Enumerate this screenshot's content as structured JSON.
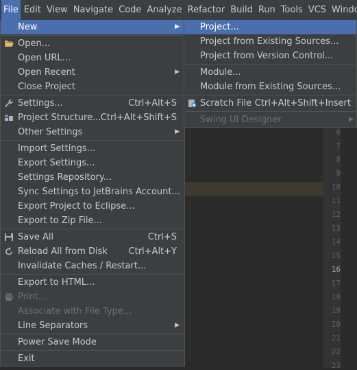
{
  "menubar": {
    "items": [
      "File",
      "Edit",
      "View",
      "Navigate",
      "Code",
      "Analyze",
      "Refactor",
      "Build",
      "Run",
      "Tools",
      "VCS",
      "Window"
    ]
  },
  "file_menu": {
    "new": "New",
    "open": "Open...",
    "open_url": "Open URL...",
    "open_recent": "Open Recent",
    "close_project": "Close Project",
    "settings": "Settings...",
    "settings_shortcut": "Ctrl+Alt+S",
    "project_structure": "Project Structure...",
    "project_structure_shortcut": "Ctrl+Alt+Shift+S",
    "other_settings": "Other Settings",
    "import_settings": "Import Settings...",
    "export_settings": "Export Settings...",
    "settings_repository": "Settings Repository...",
    "sync_settings": "Sync Settings to JetBrains Account...",
    "export_eclipse": "Export Project to Eclipse...",
    "export_zip": "Export to Zip File...",
    "save_all": "Save All",
    "save_all_shortcut": "Ctrl+S",
    "reload_all": "Reload All from Disk",
    "reload_all_shortcut": "Ctrl+Alt+Y",
    "invalidate_caches": "Invalidate Caches / Restart...",
    "export_html": "Export to HTML...",
    "print": "Print...",
    "associate_file_type": "Associate with File Type...",
    "line_separators": "Line Separators",
    "power_save": "Power Save Mode",
    "exit": "Exit"
  },
  "new_submenu": {
    "project": "Project...",
    "project_existing_sources": "Project from Existing Sources...",
    "project_version_control": "Project from Version Control...",
    "module": "Module...",
    "module_existing_sources": "Module from Existing Sources...",
    "scratch_file": "Scratch File",
    "scratch_file_shortcut": "Ctrl+Alt+Shift+Insert",
    "swing_ui_designer": "Swing UI Designer"
  },
  "editor": {
    "line_numbers": [
      "6",
      "7",
      "8",
      "9",
      "10",
      "11",
      "12",
      "13",
      "14",
      "15",
      "16",
      "17",
      "18",
      "19",
      "20",
      "21",
      "22",
      "23"
    ],
    "current_line": "16"
  },
  "colors": {
    "selection": "#4b6eaf",
    "menu_bg": "#3c3f41",
    "editor_bg": "#2b2b2b",
    "gutter_bg": "#313335"
  }
}
